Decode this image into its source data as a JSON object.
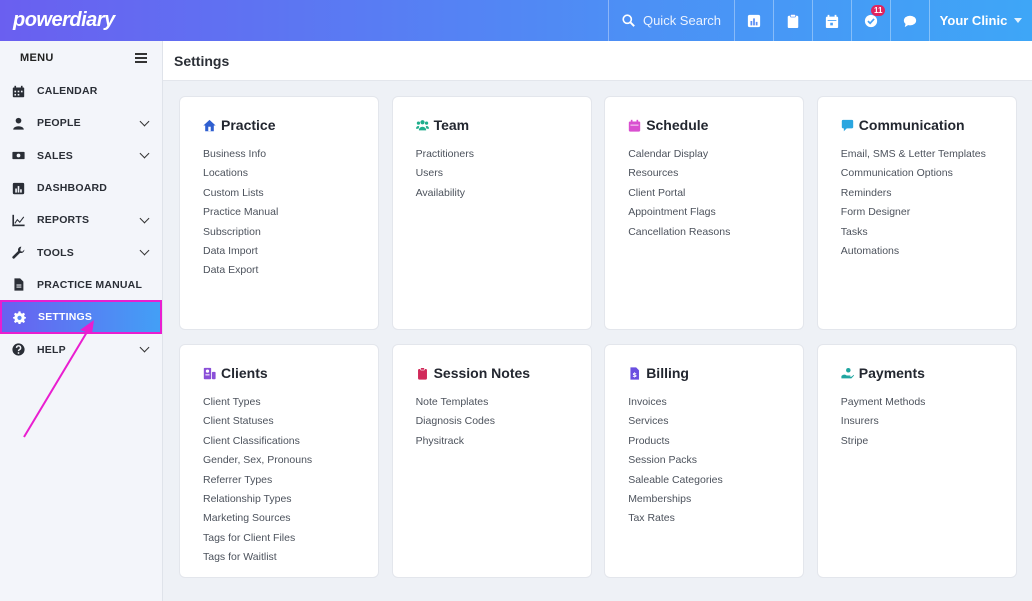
{
  "app": {
    "logo": "powerdiary"
  },
  "topbar": {
    "search_label": "Quick Search",
    "notification_count": "11",
    "clinic_label": "Your Clinic"
  },
  "sidebar": {
    "menu_label": "MENU",
    "items": [
      {
        "label": "CALENDAR",
        "icon": "calendar-icon",
        "expandable": false
      },
      {
        "label": "PEOPLE",
        "icon": "user-icon",
        "expandable": true
      },
      {
        "label": "SALES",
        "icon": "money-icon",
        "expandable": true
      },
      {
        "label": "DASHBOARD",
        "icon": "dashboard-icon",
        "expandable": false
      },
      {
        "label": "REPORTS",
        "icon": "chart-icon",
        "expandable": true
      },
      {
        "label": "TOOLS",
        "icon": "wrench-icon",
        "expandable": true
      },
      {
        "label": "PRACTICE MANUAL",
        "icon": "document-icon",
        "expandable": false
      },
      {
        "label": "SETTINGS",
        "icon": "gear-icon",
        "expandable": false,
        "active": true
      },
      {
        "label": "HELP",
        "icon": "question-icon",
        "expandable": true
      }
    ]
  },
  "page": {
    "title": "Settings"
  },
  "cards": [
    {
      "title": "Practice",
      "icon": "home-icon",
      "color": "#2f5fd0",
      "links": [
        "Business Info",
        "Locations",
        "Custom Lists",
        "Practice Manual",
        "Subscription",
        "Data Import",
        "Data Export"
      ]
    },
    {
      "title": "Team",
      "icon": "team-icon",
      "color": "#1fae8c",
      "links": [
        "Practitioners",
        "Users",
        "Availability"
      ]
    },
    {
      "title": "Schedule",
      "icon": "calendar-icon",
      "color": "#d94fd0",
      "links": [
        "Calendar Display",
        "Resources",
        "Client Portal",
        "Appointment Flags",
        "Cancellation Reasons"
      ]
    },
    {
      "title": "Communication",
      "icon": "chat-icon",
      "color": "#2ba6e0",
      "links": [
        "Email, SMS & Letter Templates",
        "Communication Options",
        "Reminders",
        "Form Designer",
        "Tasks",
        "Automations"
      ]
    },
    {
      "title": "Clients",
      "icon": "clients-icon",
      "color": "#8a4fd8",
      "links": [
        "Client Types",
        "Client Statuses",
        "Client Classifications",
        "Gender, Sex, Pronouns",
        "Referrer Types",
        "Relationship Types",
        "Marketing Sources",
        "Tags for Client Files",
        "Tags for Waitlist"
      ]
    },
    {
      "title": "Session Notes",
      "icon": "clipboard-icon",
      "color": "#d12a5a",
      "links": [
        "Note Templates",
        "Diagnosis Codes",
        "Physitrack"
      ]
    },
    {
      "title": "Billing",
      "icon": "invoice-icon",
      "color": "#6a4fe0",
      "links": [
        "Invoices",
        "Services",
        "Products",
        "Session Packs",
        "Saleable Categories",
        "Memberships",
        "Tax Rates"
      ]
    },
    {
      "title": "Payments",
      "icon": "hand-money-icon",
      "color": "#1fa5a0",
      "links": [
        "Payment Methods",
        "Insurers",
        "Stripe"
      ]
    }
  ]
}
